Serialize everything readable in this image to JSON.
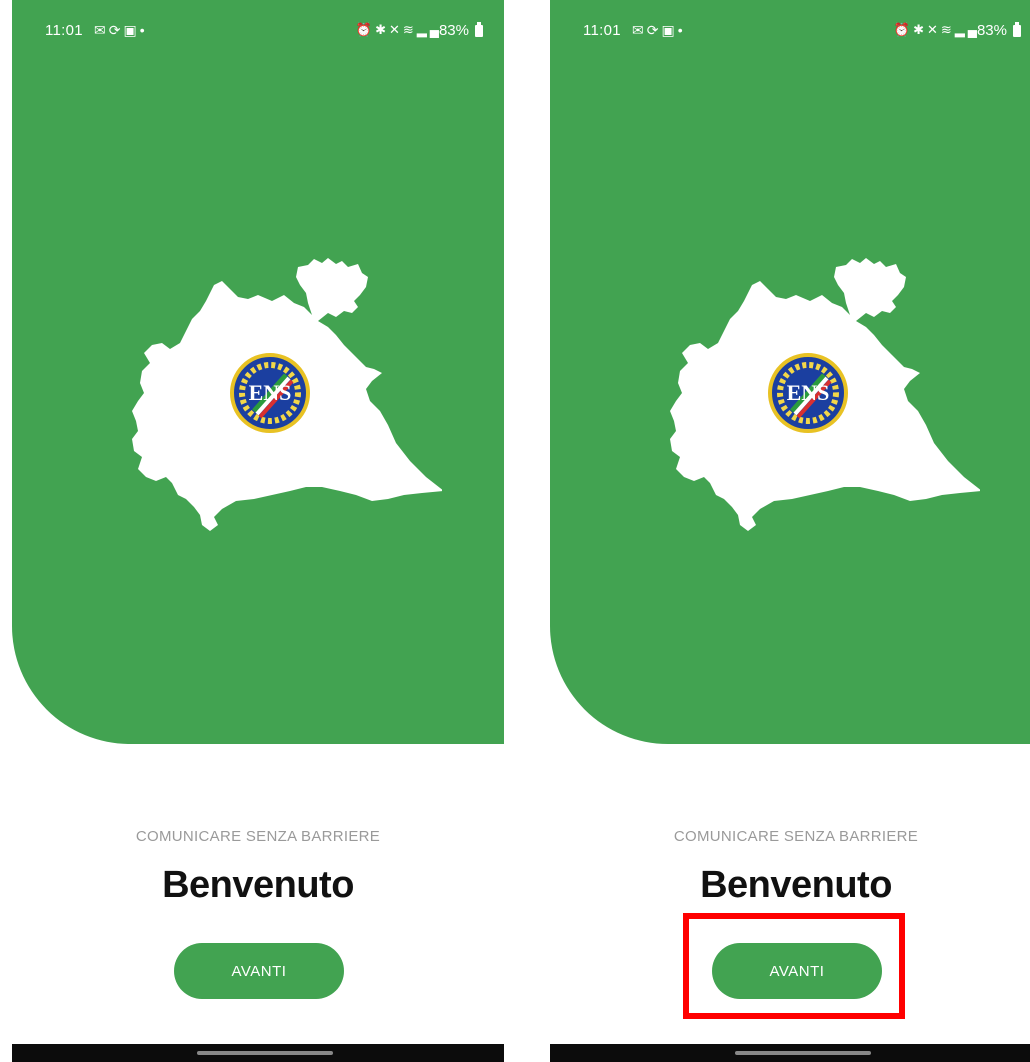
{
  "colors": {
    "brand_green": "#42a351",
    "highlight_red": "#ff0000",
    "subtitle_gray": "#9a9a9a"
  },
  "status_bar": {
    "time": "11:01",
    "left_icons": [
      "mail-icon",
      "sync-icon",
      "image-icon",
      "dot-icon"
    ],
    "right_icons": [
      "alarm-icon",
      "bluetooth-icon",
      "mute-icon",
      "wifi-icon",
      "signal-icon",
      "signal-icon"
    ],
    "battery": "83%"
  },
  "welcome": {
    "subtitle": "COMUNICARE SENZA BARRIERE",
    "title": "Benvenuto",
    "button_label": "AVANTI"
  },
  "logo": {
    "seal_text": "ENS"
  }
}
